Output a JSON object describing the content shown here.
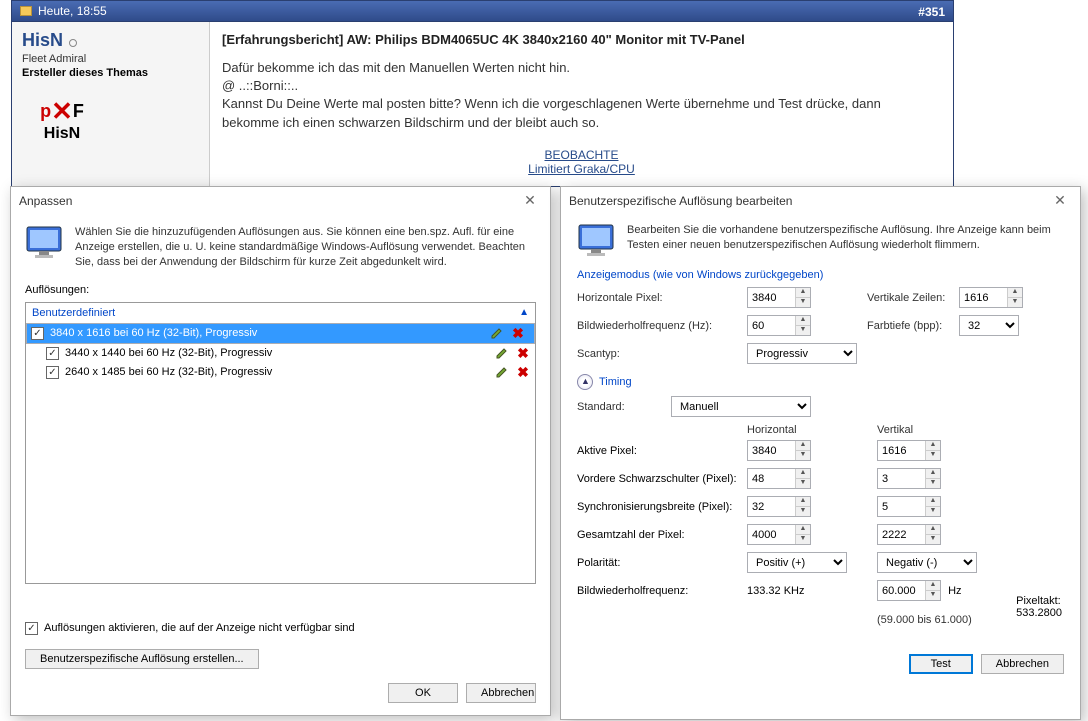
{
  "forum": {
    "timestamp": "Heute, 18:55",
    "post_number": "#351",
    "username": "HisN",
    "rank": "Fleet Admiral",
    "starter": "Ersteller dieses Themas",
    "title": "[Erfahrungsbericht] AW: Philips BDM4065UC 4K 3840x2160 40\" Monitor mit TV-Panel",
    "body_line1": "Dafür bekomme ich das mit den Manuellen Werten nicht hin.",
    "body_line2": "@ ..::Borni::..",
    "body_line3": "Kannst Du Deine Werte mal posten bitte? Wenn ich die vorgeschlagenen Werte übernehme und Test drücke, dann bekomme ich einen schwarzen Bildschirm und der bleibt auch so.",
    "link1": "BEOBACHTE",
    "link2": "Limitiert Graka/CPU"
  },
  "anpassen": {
    "title": "Anpassen",
    "intro": "Wählen Sie die hinzuzufügenden Auflösungen aus. Sie können eine ben.spz. Aufl. für eine Anzeige erstellen, die u. U. keine standardmäßige Windows-Auflösung verwendet. Beachten Sie, dass bei der Anwendung der Bildschirm für kurze Zeit abgedunkelt wird.",
    "list_label": "Auflösungen:",
    "tree_header": "Benutzerdefiniert",
    "resolutions": [
      {
        "label": "3840 x 1616 bei 60 Hz (32-Bit), Progressiv",
        "selected": true
      },
      {
        "label": "3440 x 1440 bei 60 Hz (32-Bit), Progressiv",
        "selected": false
      },
      {
        "label": "2640 x 1485 bei 60 Hz (32-Bit), Progressiv",
        "selected": false
      }
    ],
    "enable_unavailable": "Auflösungen aktivieren, die auf der Anzeige nicht verfügbar sind",
    "create_btn": "Benutzerspezifische Auflösung erstellen...",
    "ok": "OK",
    "cancel": "Abbrechen"
  },
  "bearb": {
    "title": "Benutzerspezifische Auflösung bearbeiten",
    "intro": "Bearbeiten Sie die vorhandene benutzerspezifische Auflösung. Ihre Anzeige kann beim Testen einer neuen benutzerspezifischen Auflösung wiederholt flimmern.",
    "display_mode_hdr": "Anzeigemodus (wie von Windows zurückgegeben)",
    "hpixel_label": "Horizontale Pixel:",
    "hpixel": "3840",
    "vlines_label": "Vertikale Zeilen:",
    "vlines": "1616",
    "refresh_label": "Bildwiederholfrequenz (Hz):",
    "refresh": "60",
    "depth_label": "Farbtiefe (bpp):",
    "depth": "32",
    "scantype_label": "Scantyp:",
    "scantype": "Progressiv",
    "timing_hdr": "Timing",
    "standard_label": "Standard:",
    "standard": "Manuell",
    "horizontal": "Horizontal",
    "vertical": "Vertikal",
    "active_label": "Aktive Pixel:",
    "active_h": "3840",
    "active_v": "1616",
    "porch_label": "Vordere Schwarzschulter (Pixel):",
    "porch_h": "48",
    "porch_v": "3",
    "sync_label": "Synchronisierungsbreite (Pixel):",
    "sync_h": "32",
    "sync_v": "5",
    "total_label": "Gesamtzahl der Pixel:",
    "total_h": "4000",
    "total_v": "2222",
    "polarity_label": "Polarität:",
    "polarity_h": "Positiv (+)",
    "polarity_v": "Negativ (-)",
    "refresh2_label": "Bildwiederholfrequenz:",
    "refresh2_h": "133.32 KHz",
    "refresh2_v": "60.000",
    "hz": "Hz",
    "pixelclock_label": "Pixeltakt:",
    "pixelclock": "533.2800",
    "range": "(59.000 bis 61.000)",
    "test": "Test",
    "cancel": "Abbrechen"
  }
}
